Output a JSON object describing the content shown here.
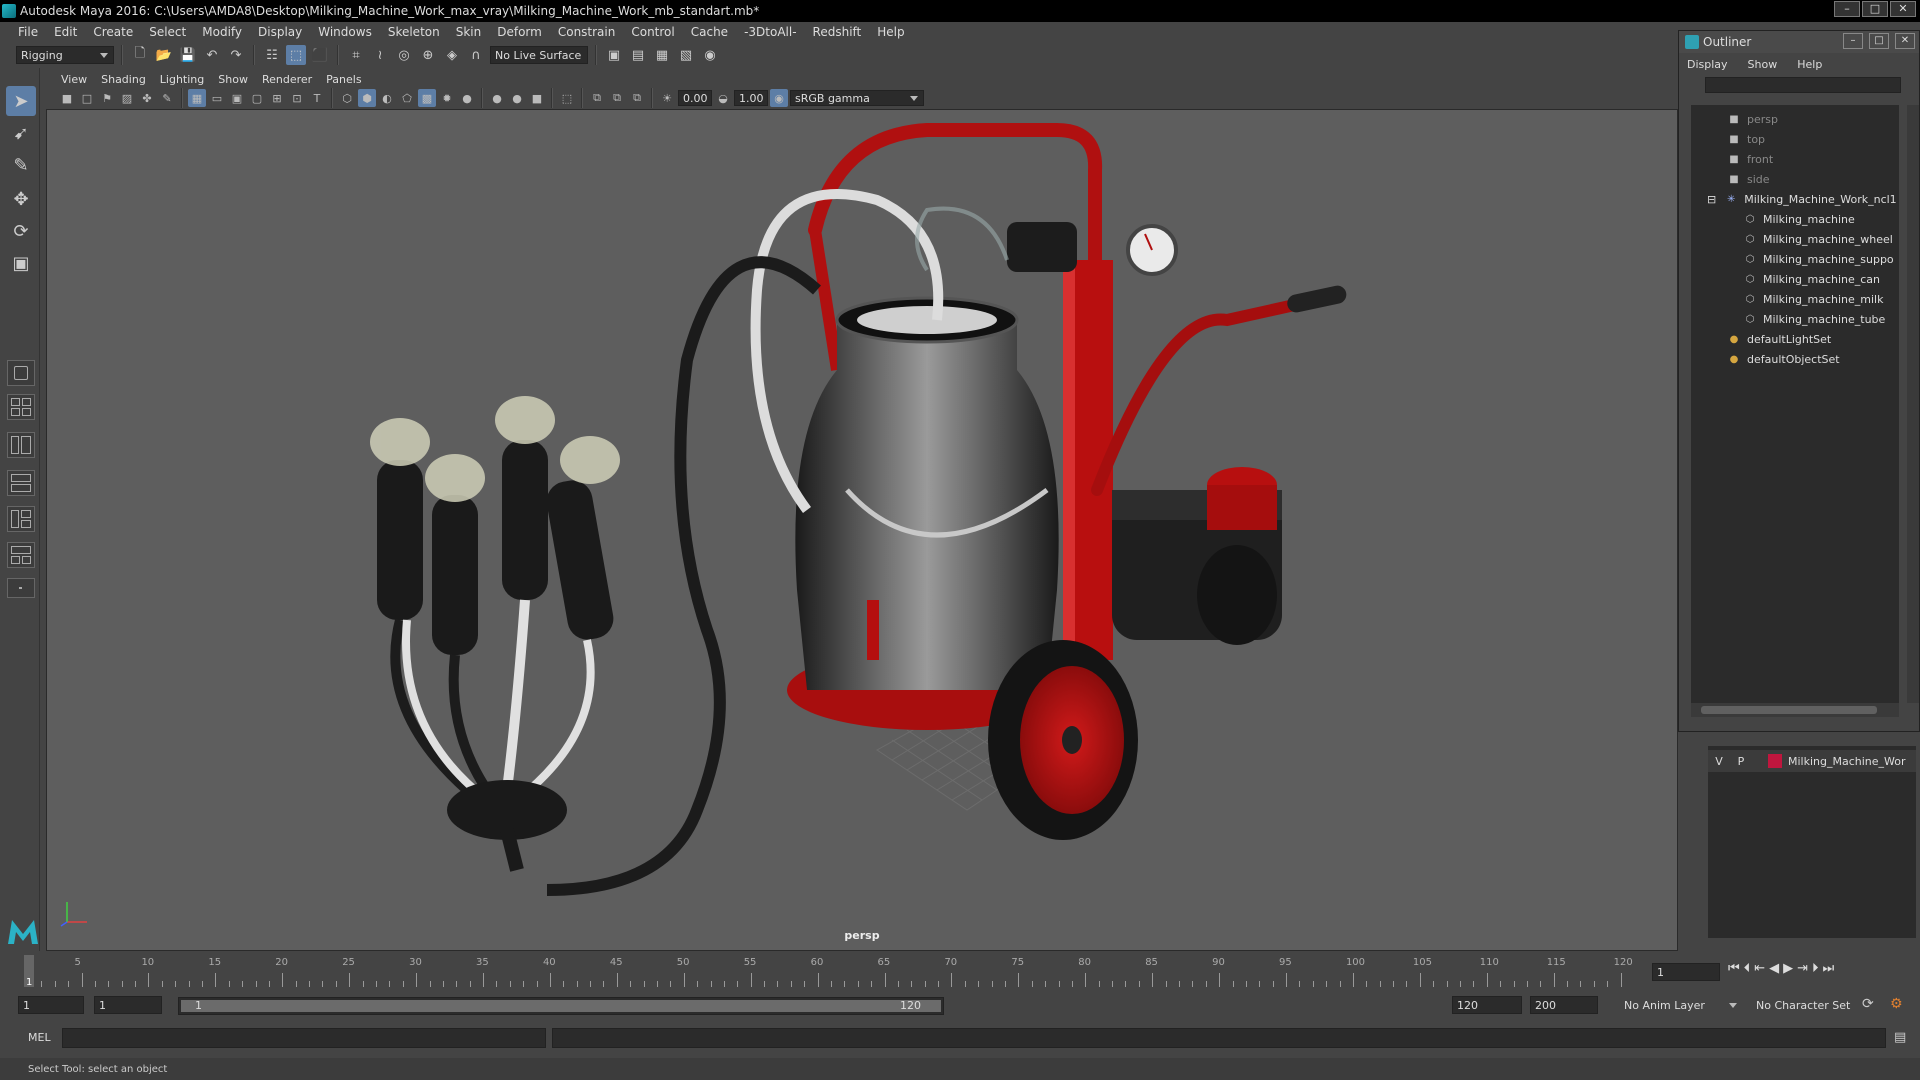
{
  "window": {
    "title": "Autodesk Maya 2016: C:\\Users\\AMDA8\\Desktop\\Milking_Machine_Work_max_vray\\Milking_Machine_Work_mb_standart.mb*",
    "controls": [
      "–",
      "□",
      "✕"
    ]
  },
  "menubar": [
    "File",
    "Edit",
    "Create",
    "Select",
    "Modify",
    "Display",
    "Windows",
    "Skeleton",
    "Skin",
    "Deform",
    "Constrain",
    "Control",
    "Cache",
    "-3DtoAll-",
    "Redshift",
    "Help"
  ],
  "statusline": {
    "mode": "Rigging",
    "live_surface": "No Live Surface"
  },
  "viewport": {
    "menu": [
      "View",
      "Shading",
      "Lighting",
      "Show",
      "Renderer",
      "Panels"
    ],
    "exposure": "0.00",
    "gamma": "1.00",
    "colorspace": "sRGB gamma",
    "camera_label": "persp"
  },
  "outliner": {
    "title": "Outliner",
    "menu": [
      "Display",
      "Show",
      "Help"
    ],
    "items": [
      {
        "label": "persp",
        "type": "camera",
        "indent": 0
      },
      {
        "label": "top",
        "type": "camera",
        "indent": 0
      },
      {
        "label": "front",
        "type": "camera",
        "indent": 0
      },
      {
        "label": "side",
        "type": "camera",
        "indent": 0
      },
      {
        "label": "Milking_Machine_Work_ncl1",
        "type": "group",
        "indent": 0
      },
      {
        "label": "Milking_machine",
        "type": "mesh",
        "indent": 1
      },
      {
        "label": "Milking_machine_wheel",
        "type": "mesh",
        "indent": 1
      },
      {
        "label": "Milking_machine_suppo",
        "type": "mesh",
        "indent": 1
      },
      {
        "label": "Milking_machine_can",
        "type": "mesh",
        "indent": 1
      },
      {
        "label": "Milking_machine_milk",
        "type": "mesh",
        "indent": 1
      },
      {
        "label": "Milking_machine_tube",
        "type": "mesh",
        "indent": 1
      },
      {
        "label": "defaultLightSet",
        "type": "set",
        "indent": 0
      },
      {
        "label": "defaultObjectSet",
        "type": "set",
        "indent": 0
      }
    ]
  },
  "layers": {
    "v": "V",
    "p": "P",
    "name": "Milking_Machine_Wor",
    "color": "#c0163e"
  },
  "timeline": {
    "labels": [
      "5",
      "10",
      "15",
      "20",
      "25",
      "30",
      "35",
      "40",
      "45",
      "50",
      "55",
      "60",
      "65",
      "70",
      "75",
      "80",
      "85",
      "90",
      "95",
      "100",
      "105",
      "110",
      "115",
      "120"
    ],
    "start_label": "1",
    "current_frame": "1"
  },
  "range": {
    "start": "1",
    "range_start": "1",
    "slider_start": "1",
    "slider_end": "120",
    "end": "120",
    "max": "200",
    "anim_layer": "No Anim Layer",
    "character_set": "No Character Set"
  },
  "cmdline": {
    "lang": "MEL",
    "help_text": "Select Tool: select an object"
  }
}
